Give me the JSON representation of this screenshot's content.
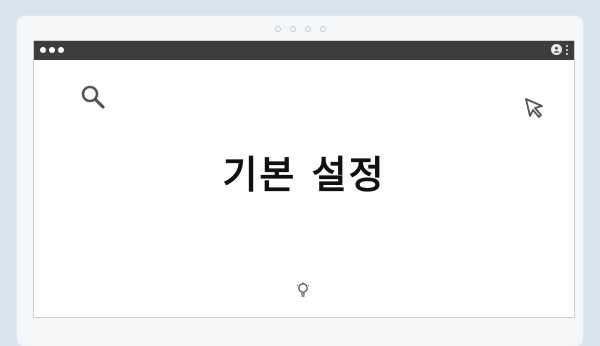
{
  "page": {
    "title": "기본 설정"
  },
  "icons": {
    "search": "search-icon",
    "cursor": "cursor-arrow-icon",
    "lightbulb": "lightbulb-icon",
    "account": "account-icon",
    "menu": "more-vertical-icon"
  },
  "colors": {
    "background": "#d9e3ed",
    "titlebar": "#3d3d3d",
    "text": "#111111"
  }
}
